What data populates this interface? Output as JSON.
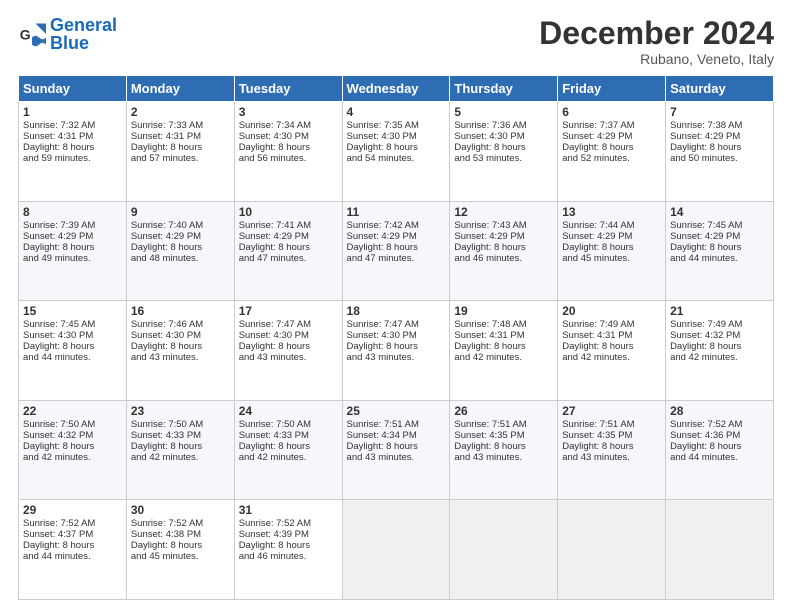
{
  "logo": {
    "line1": "General",
    "line2": "Blue"
  },
  "title": "December 2024",
  "subtitle": "Rubano, Veneto, Italy",
  "days_header": [
    "Sunday",
    "Monday",
    "Tuesday",
    "Wednesday",
    "Thursday",
    "Friday",
    "Saturday"
  ],
  "weeks": [
    [
      {
        "day": "1",
        "lines": [
          "Sunrise: 7:32 AM",
          "Sunset: 4:31 PM",
          "Daylight: 8 hours",
          "and 59 minutes."
        ]
      },
      {
        "day": "2",
        "lines": [
          "Sunrise: 7:33 AM",
          "Sunset: 4:31 PM",
          "Daylight: 8 hours",
          "and 57 minutes."
        ]
      },
      {
        "day": "3",
        "lines": [
          "Sunrise: 7:34 AM",
          "Sunset: 4:30 PM",
          "Daylight: 8 hours",
          "and 56 minutes."
        ]
      },
      {
        "day": "4",
        "lines": [
          "Sunrise: 7:35 AM",
          "Sunset: 4:30 PM",
          "Daylight: 8 hours",
          "and 54 minutes."
        ]
      },
      {
        "day": "5",
        "lines": [
          "Sunrise: 7:36 AM",
          "Sunset: 4:30 PM",
          "Daylight: 8 hours",
          "and 53 minutes."
        ]
      },
      {
        "day": "6",
        "lines": [
          "Sunrise: 7:37 AM",
          "Sunset: 4:29 PM",
          "Daylight: 8 hours",
          "and 52 minutes."
        ]
      },
      {
        "day": "7",
        "lines": [
          "Sunrise: 7:38 AM",
          "Sunset: 4:29 PM",
          "Daylight: 8 hours",
          "and 50 minutes."
        ]
      }
    ],
    [
      {
        "day": "8",
        "lines": [
          "Sunrise: 7:39 AM",
          "Sunset: 4:29 PM",
          "Daylight: 8 hours",
          "and 49 minutes."
        ]
      },
      {
        "day": "9",
        "lines": [
          "Sunrise: 7:40 AM",
          "Sunset: 4:29 PM",
          "Daylight: 8 hours",
          "and 48 minutes."
        ]
      },
      {
        "day": "10",
        "lines": [
          "Sunrise: 7:41 AM",
          "Sunset: 4:29 PM",
          "Daylight: 8 hours",
          "and 47 minutes."
        ]
      },
      {
        "day": "11",
        "lines": [
          "Sunrise: 7:42 AM",
          "Sunset: 4:29 PM",
          "Daylight: 8 hours",
          "and 47 minutes."
        ]
      },
      {
        "day": "12",
        "lines": [
          "Sunrise: 7:43 AM",
          "Sunset: 4:29 PM",
          "Daylight: 8 hours",
          "and 46 minutes."
        ]
      },
      {
        "day": "13",
        "lines": [
          "Sunrise: 7:44 AM",
          "Sunset: 4:29 PM",
          "Daylight: 8 hours",
          "and 45 minutes."
        ]
      },
      {
        "day": "14",
        "lines": [
          "Sunrise: 7:45 AM",
          "Sunset: 4:29 PM",
          "Daylight: 8 hours",
          "and 44 minutes."
        ]
      }
    ],
    [
      {
        "day": "15",
        "lines": [
          "Sunrise: 7:45 AM",
          "Sunset: 4:30 PM",
          "Daylight: 8 hours",
          "and 44 minutes."
        ]
      },
      {
        "day": "16",
        "lines": [
          "Sunrise: 7:46 AM",
          "Sunset: 4:30 PM",
          "Daylight: 8 hours",
          "and 43 minutes."
        ]
      },
      {
        "day": "17",
        "lines": [
          "Sunrise: 7:47 AM",
          "Sunset: 4:30 PM",
          "Daylight: 8 hours",
          "and 43 minutes."
        ]
      },
      {
        "day": "18",
        "lines": [
          "Sunrise: 7:47 AM",
          "Sunset: 4:30 PM",
          "Daylight: 8 hours",
          "and 43 minutes."
        ]
      },
      {
        "day": "19",
        "lines": [
          "Sunrise: 7:48 AM",
          "Sunset: 4:31 PM",
          "Daylight: 8 hours",
          "and 42 minutes."
        ]
      },
      {
        "day": "20",
        "lines": [
          "Sunrise: 7:49 AM",
          "Sunset: 4:31 PM",
          "Daylight: 8 hours",
          "and 42 minutes."
        ]
      },
      {
        "day": "21",
        "lines": [
          "Sunrise: 7:49 AM",
          "Sunset: 4:32 PM",
          "Daylight: 8 hours",
          "and 42 minutes."
        ]
      }
    ],
    [
      {
        "day": "22",
        "lines": [
          "Sunrise: 7:50 AM",
          "Sunset: 4:32 PM",
          "Daylight: 8 hours",
          "and 42 minutes."
        ]
      },
      {
        "day": "23",
        "lines": [
          "Sunrise: 7:50 AM",
          "Sunset: 4:33 PM",
          "Daylight: 8 hours",
          "and 42 minutes."
        ]
      },
      {
        "day": "24",
        "lines": [
          "Sunrise: 7:50 AM",
          "Sunset: 4:33 PM",
          "Daylight: 8 hours",
          "and 42 minutes."
        ]
      },
      {
        "day": "25",
        "lines": [
          "Sunrise: 7:51 AM",
          "Sunset: 4:34 PM",
          "Daylight: 8 hours",
          "and 43 minutes."
        ]
      },
      {
        "day": "26",
        "lines": [
          "Sunrise: 7:51 AM",
          "Sunset: 4:35 PM",
          "Daylight: 8 hours",
          "and 43 minutes."
        ]
      },
      {
        "day": "27",
        "lines": [
          "Sunrise: 7:51 AM",
          "Sunset: 4:35 PM",
          "Daylight: 8 hours",
          "and 43 minutes."
        ]
      },
      {
        "day": "28",
        "lines": [
          "Sunrise: 7:52 AM",
          "Sunset: 4:36 PM",
          "Daylight: 8 hours",
          "and 44 minutes."
        ]
      }
    ],
    [
      {
        "day": "29",
        "lines": [
          "Sunrise: 7:52 AM",
          "Sunset: 4:37 PM",
          "Daylight: 8 hours",
          "and 44 minutes."
        ]
      },
      {
        "day": "30",
        "lines": [
          "Sunrise: 7:52 AM",
          "Sunset: 4:38 PM",
          "Daylight: 8 hours",
          "and 45 minutes."
        ]
      },
      {
        "day": "31",
        "lines": [
          "Sunrise: 7:52 AM",
          "Sunset: 4:39 PM",
          "Daylight: 8 hours",
          "and 46 minutes."
        ]
      },
      null,
      null,
      null,
      null
    ]
  ]
}
